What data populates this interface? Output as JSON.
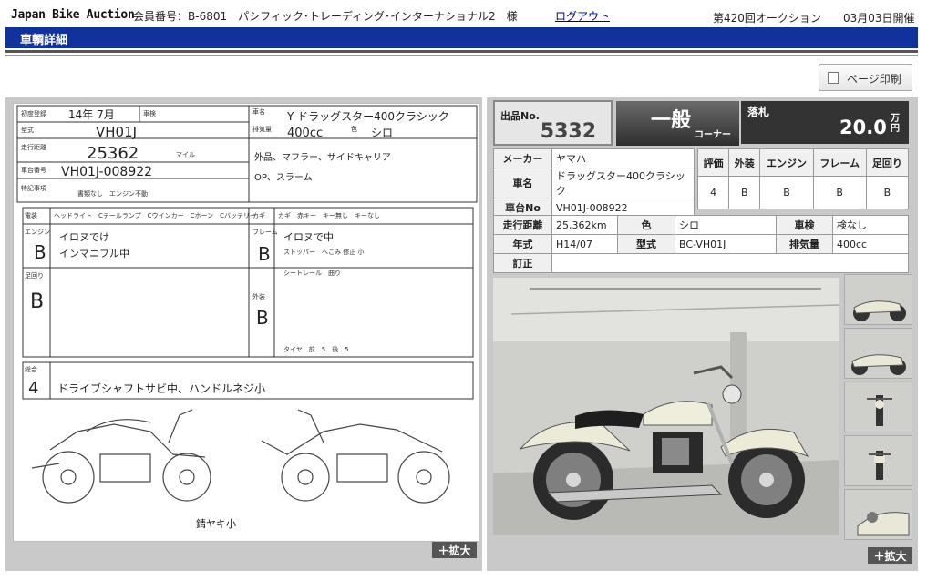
{
  "header": {
    "logo": "Japan Bike Auction",
    "member_text": "会員番号：B-6801　パシフィック･トレーディング･インターナショナル2　様",
    "logout": "ログアウト",
    "auction_no": "第420回オークション",
    "auction_date": "03月03日開催"
  },
  "page_title": "車輌詳細",
  "print_button": "ページ印刷",
  "zoom_label": "＋拡大",
  "lot": {
    "label": "出品No.",
    "number": "5332",
    "corner_main": "一般",
    "corner_sub": "コーナー",
    "price_label": "落札",
    "price": "20.0",
    "price_unit": "万円"
  },
  "vehicle": {
    "maker_label": "メーカー",
    "maker": "ヤマハ",
    "name_label": "車名",
    "name": "ドラッグスター400クラシック",
    "frame_label": "車台No",
    "frame": "VH01J-008922"
  },
  "grades": {
    "headers": [
      "評価",
      "外装",
      "エンジン",
      "フレーム",
      "足回り"
    ],
    "values": [
      "4",
      "B",
      "B",
      "B",
      "B"
    ]
  },
  "specs": {
    "mileage_label": "走行距離",
    "mileage": "25,362km",
    "color_label": "色",
    "color": "シロ",
    "inspection_label": "車検",
    "inspection": "検なし",
    "year_label": "年式",
    "year": "H14/07",
    "model_label": "型式",
    "model": "BC-VH01J",
    "displacement_label": "排気量",
    "displacement": "400cc",
    "correction_label": "訂正",
    "correction": ""
  },
  "sheet": {
    "first_reg": "初度登録",
    "reg_date": "14年 7月",
    "inspection": "車検",
    "model_type": "型式",
    "model_value": "VH01J",
    "car_name_label": "車名",
    "car_name": "Y ドラッグスター400クラシック",
    "displacement_label": "排気量",
    "displacement": "400cc",
    "color_label": "色",
    "color": "シロ",
    "mileage_label": "走行距離",
    "mileage": "25362",
    "mileage_unit": "マイル",
    "frame_label": "車台番号",
    "frame": "VH01J-008922",
    "special_label": "特記事項",
    "special_items": "書類なし　エンジン不動",
    "extras_1": "外品、マフラー、サイドキャリア",
    "extras_2": "OP、スラーム",
    "electric_label": "電装",
    "electric_items": "ヘッドライト　Cテールランプ　Cウインカー　Cホーン　Cバッテリー",
    "key_label": "カギ",
    "key_items": "カギ　赤キー　キー無し　キーなし",
    "engine_label": "エンジン",
    "engine_grade": "B",
    "engine_note_1": "イロヌでけ",
    "engine_note_2": "インマニフル中",
    "frame_section_label": "フレーム",
    "frame_grade": "B",
    "frame_note_1": "イロヌで中",
    "frame_note_2": "ストッパー　へこみ 修正 小",
    "frame_note_3": "シートレール　曲り",
    "suspension_label": "足回り",
    "suspension_grade": "B",
    "exterior_label": "外装",
    "exterior_grade": "B",
    "tire_label": "タイヤ　前　5　後　5",
    "total_label": "総合",
    "total_grade": "4",
    "total_note": "ドライブシャフトサビ中、ハンドルネジ小",
    "diagram_note": "錆ヤキ小"
  }
}
